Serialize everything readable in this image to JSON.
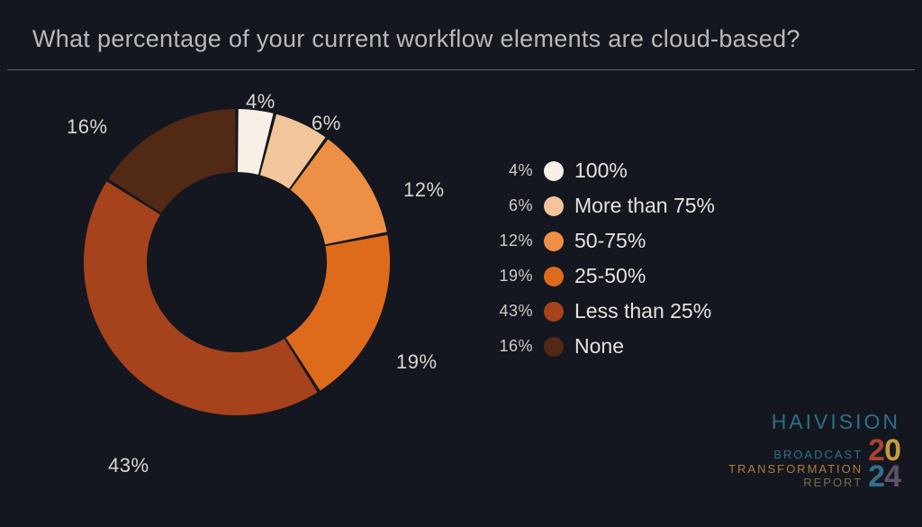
{
  "title": "What percentage of your current workflow elements are cloud-based?",
  "chart_data": {
    "type": "pie",
    "subtype": "donut",
    "categories": [
      "100%",
      "More than 75%",
      "50-75%",
      "25-50%",
      "Less than 25%",
      "None"
    ],
    "values": [
      4,
      6,
      12,
      19,
      43,
      16
    ],
    "series": [
      {
        "name": "100%",
        "value": 4,
        "color": "#f6f0e6"
      },
      {
        "name": "More than 75%",
        "value": 6,
        "color": "#f3c59a"
      },
      {
        "name": "50-75%",
        "value": 12,
        "color": "#ed9045"
      },
      {
        "name": "25-50%",
        "value": 19,
        "color": "#de6a1c"
      },
      {
        "name": "Less than 25%",
        "value": 43,
        "color": "#a6421c"
      },
      {
        "name": "None",
        "value": 16,
        "color": "#512915"
      }
    ],
    "title": "What percentage of your current workflow elements are cloud-based?"
  },
  "legend": [
    {
      "pct": "4%",
      "label": "100%"
    },
    {
      "pct": "6%",
      "label": "More than 75%"
    },
    {
      "pct": "12%",
      "label": "50-75%"
    },
    {
      "pct": "19%",
      "label": "25-50%"
    },
    {
      "pct": "43%",
      "label": "Less than 25%"
    },
    {
      "pct": "16%",
      "label": "None"
    }
  ],
  "slice_labels": [
    "4%",
    "6%",
    "12%",
    "19%",
    "43%",
    "16%"
  ],
  "branding": {
    "company": "HAIVISION",
    "line1": "BROADCAST",
    "line2": "TRANSFORMATION",
    "line3": "REPORT",
    "year_digits": [
      "2",
      "0",
      "2",
      "4"
    ]
  },
  "colors": {
    "background": "#14171f",
    "text": "#c9c8c7"
  }
}
